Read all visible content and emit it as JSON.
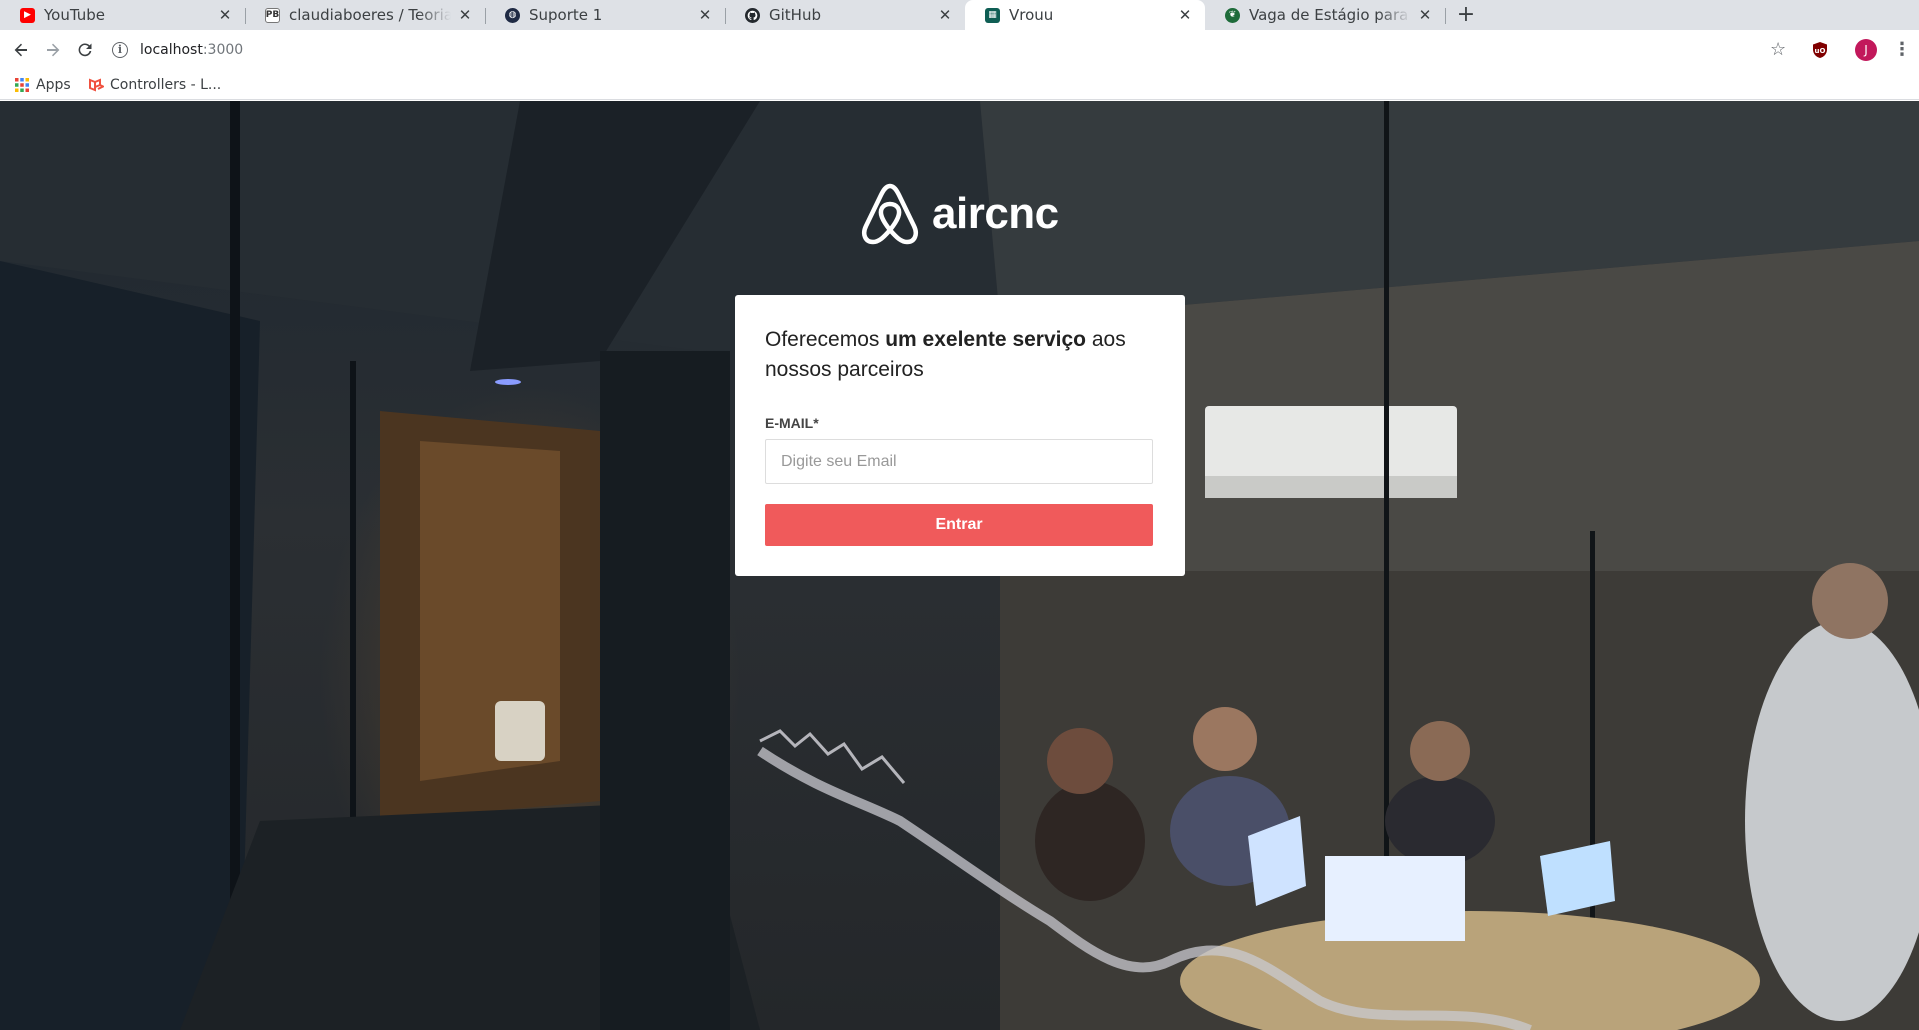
{
  "browser": {
    "tabs": [
      {
        "title": "YouTube",
        "favicon": "youtube-icon",
        "active": false
      },
      {
        "title": "claudiaboeres / Teoria dos Grafos",
        "favicon": "pb-icon",
        "active": false
      },
      {
        "title": "Suporte 1",
        "favicon": "globe-icon",
        "active": false
      },
      {
        "title": "GitHub",
        "favicon": "github-icon",
        "active": false
      },
      {
        "title": "Vrouu",
        "favicon": "vrouu-icon",
        "active": true
      },
      {
        "title": "Vaga de Estágio para Desenvolvedor",
        "favicon": "leaf-icon",
        "active": false
      }
    ],
    "pb_favicon_text": "PB",
    "url_host": "localhost",
    "url_port": ":3000",
    "profile_initial": "J",
    "bookmarks": [
      {
        "label": "Apps"
      },
      {
        "label": "Controllers - L..."
      }
    ]
  },
  "page": {
    "logo_text": "aircnc",
    "lead_prefix": "Oferecemos ",
    "lead_bold": "um exelente serviço",
    "lead_suffix": " aos nossos parceiros",
    "email_label": "E-MAIL*",
    "email_placeholder": "Digite seu Email",
    "email_value": "",
    "submit_label": "Entrar"
  },
  "colors": {
    "accent": "#f05a5b",
    "tabstrip": "#dee1e6",
    "profile": "#c2185b"
  }
}
